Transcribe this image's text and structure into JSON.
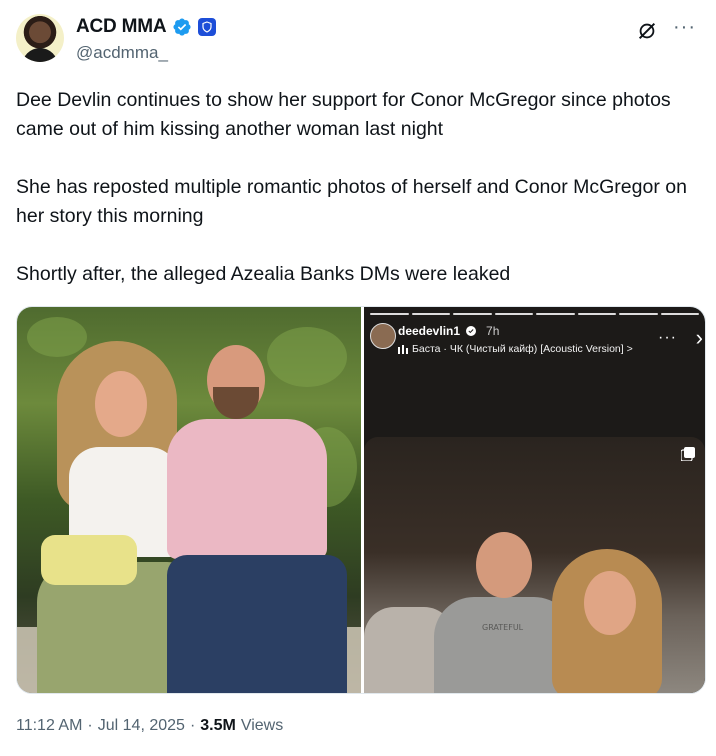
{
  "author": {
    "display_name": "ACD MMA",
    "handle": "@acdmma_",
    "avatar_icon": "user-avatar",
    "verified_icon": "verified-badge-icon",
    "affiliate_icon": "affiliate-badge-icon",
    "brand_blue": "#1d9bf0"
  },
  "actions": {
    "grok_icon": "grok-icon",
    "more_label": "···"
  },
  "tweet": {
    "paragraphs": [
      "Dee Devlin continues to show her support for Conor McGregor since photos came out of him kissing another woman last night",
      "She has reposted multiple romantic photos of herself and Conor McGregor on her story this morning",
      "Shortly after, the alleged Azealia Banks DMs were leaked"
    ]
  },
  "media": {
    "story": {
      "username": "deedevlin1",
      "time": "7h",
      "music": "Баста · ЧК (Чистый кайф) [Acoustic Version] >",
      "music_icon": "audio-bars-icon",
      "more_label": "···",
      "next_label": "›",
      "shirt_text": "GRATEFUL"
    }
  },
  "footer": {
    "time": "11:12 AM",
    "sep1": "·",
    "date": "Jul 14, 2025",
    "sep2": "·",
    "views_count": "3.5M",
    "views_label": "Views"
  }
}
